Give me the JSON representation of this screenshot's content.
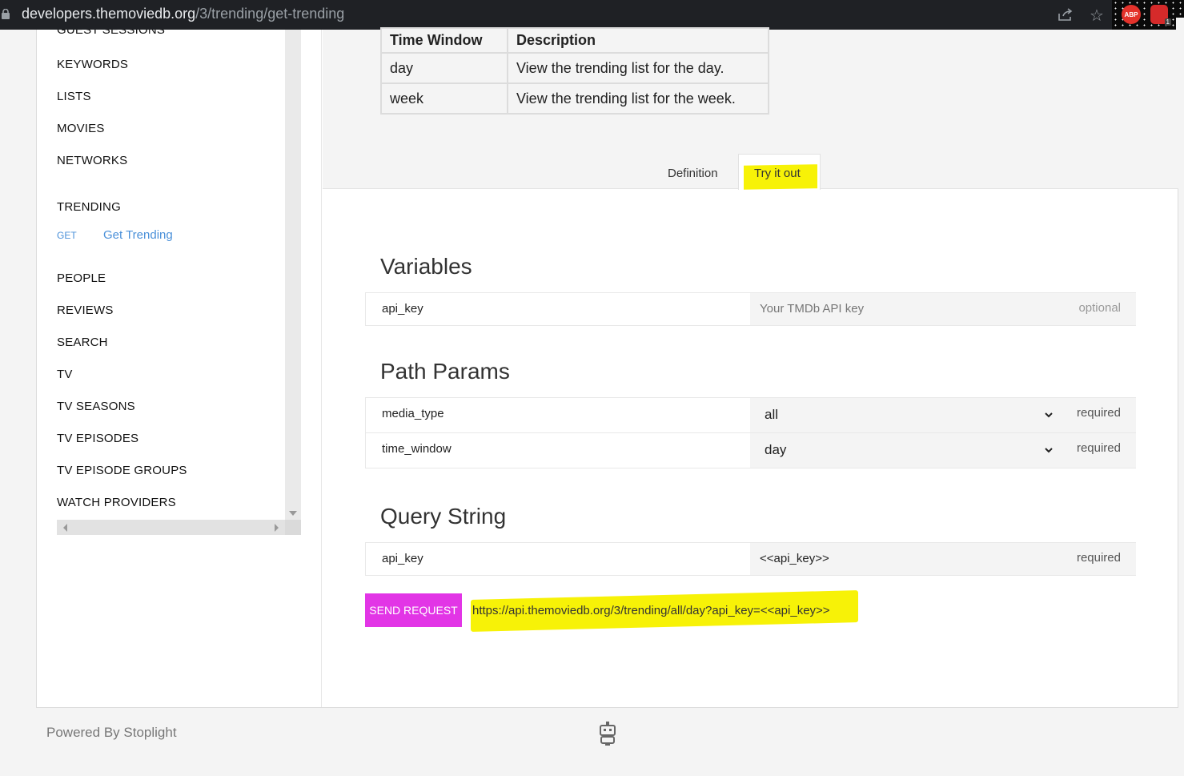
{
  "browser": {
    "url_domain": "developers.themoviedb.org",
    "url_path": "/3/trending/get-trending",
    "abp_label": "ABP",
    "ext_badge": "1"
  },
  "sidebar": {
    "items_top": [
      "GUEST SESSIONS",
      "KEYWORDS",
      "LISTS",
      "MOVIES",
      "NETWORKS",
      "TRENDING"
    ],
    "get_method": "GET",
    "get_link": "Get Trending",
    "items_bottom": [
      "PEOPLE",
      "REVIEWS",
      "SEARCH",
      "TV",
      "TV SEASONS",
      "TV EPISODES",
      "TV EPISODE GROUPS",
      "WATCH PROVIDERS"
    ]
  },
  "time_table": {
    "headers": [
      "Time Window",
      "Description"
    ],
    "rows": [
      [
        "day",
        "View the trending list for the day."
      ],
      [
        "week",
        "View the trending list for the week."
      ]
    ]
  },
  "tabs": {
    "definition": "Definition",
    "try_it_out": "Try it out"
  },
  "variables": {
    "title": "Variables",
    "name": "api_key",
    "placeholder": "Your TMDb API key",
    "status": "optional"
  },
  "path_params": {
    "title": "Path Params",
    "rows": [
      {
        "name": "media_type",
        "value": "all",
        "status": "required"
      },
      {
        "name": "time_window",
        "value": "day",
        "status": "required"
      }
    ]
  },
  "query_string": {
    "title": "Query String",
    "name": "api_key",
    "value": "<<api_key>>",
    "status": "required"
  },
  "send_button": "SEND REQUEST",
  "request_url": "https://api.themoviedb.org/3/trending/all/day?api_key=<<api_key>>",
  "footer": {
    "powered_by": "Powered By Stoplight"
  },
  "colors": {
    "send_button": "#e235e6",
    "highlight": "#f7f207",
    "link": "#4a90d9"
  }
}
